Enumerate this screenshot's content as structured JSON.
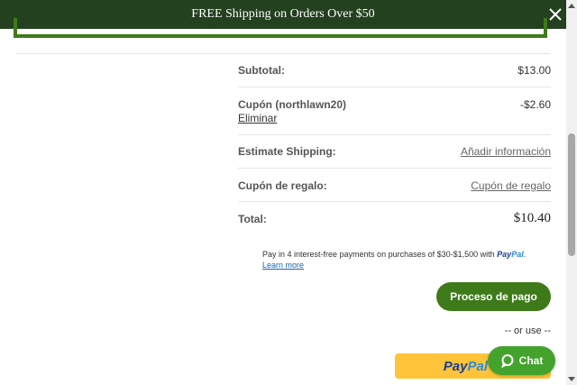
{
  "banner": {
    "text": "FREE Shipping on Orders Over $50",
    "close_icon": "close-icon"
  },
  "summary": {
    "subtotal": {
      "label": "Subtotal:",
      "value": "$13.00"
    },
    "coupon": {
      "label": "Cupón (northlawn20)",
      "remove": "Eliminar",
      "value": "-$2.60"
    },
    "shipping": {
      "label": "Estimate Shipping:",
      "link": "Añadir información"
    },
    "gift": {
      "label": "Cupón de regalo:",
      "link": "Cupón de regalo"
    },
    "total": {
      "label": "Total:",
      "value": "$10.40"
    }
  },
  "paylater": {
    "message": "Pay in 4 interest-free payments on purchases of $30-$1,500 with",
    "brand_a": "Pay",
    "brand_b": "Pal",
    "brand_suffix": ".",
    "learn_more": "Learn more"
  },
  "checkout_button": "Proceso de pago",
  "or_use": "-- or use --",
  "paypal_button": {
    "a": "Pay",
    "b": "Pal",
    "c": "Pa"
  },
  "chat": {
    "label": "Chat",
    "icon": "chat-bubble-icon"
  },
  "colors": {
    "banner_bg": "#23401f",
    "accent_green": "#3f7a1a",
    "chat_green": "#44a32c",
    "paypal_yellow": "#ffc439"
  }
}
